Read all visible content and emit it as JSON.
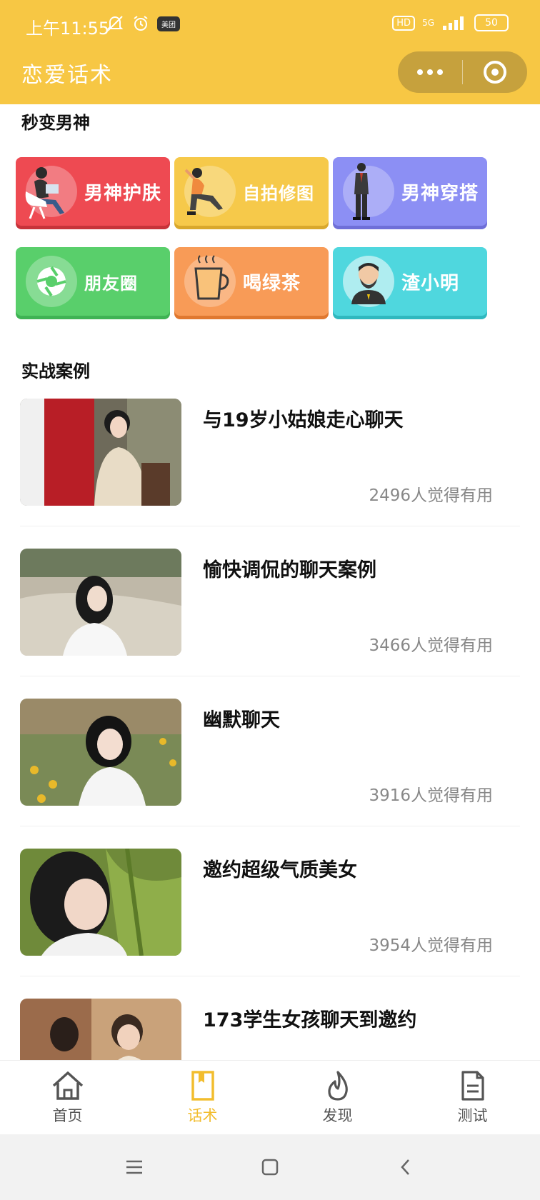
{
  "status": {
    "time": "上午11:55",
    "hd": "HD",
    "network": "5G",
    "battery": "50",
    "app_badge": "美团"
  },
  "header": {
    "title": "恋爱话术",
    "menu_icon": "more-dots-icon",
    "close_icon": "target-icon"
  },
  "section_quick": {
    "title": "秒变男神"
  },
  "tiles": [
    {
      "label": "男神护肤",
      "color": "#ee4a52",
      "icon": "person-laptop-icon"
    },
    {
      "label": "自拍修图",
      "color": "#f6c94a",
      "icon": "kneeling-woman-icon"
    },
    {
      "label": "男神穿搭",
      "color": "#8c8ff4",
      "icon": "man-suit-icon"
    },
    {
      "label": "朋友圈",
      "color": "#59cf6b",
      "icon": "camera-aperture-icon"
    },
    {
      "label": "喝绿茶",
      "color": "#f89b57",
      "icon": "tea-cup-icon"
    },
    {
      "label": "渣小明",
      "color": "#4fd7de",
      "icon": "bearded-man-icon"
    }
  ],
  "section_cases": {
    "title": "实战案例"
  },
  "cases": [
    {
      "title": "与19岁小姑娘走心聊天",
      "count": "2496人觉得有用"
    },
    {
      "title": "愉快调侃的聊天案例",
      "count": "3466人觉得有用"
    },
    {
      "title": "幽默聊天",
      "count": "3916人觉得有用"
    },
    {
      "title": "邀约超级气质美女",
      "count": "3954人觉得有用"
    },
    {
      "title": "173学生女孩聊天到邀约",
      "count": ""
    }
  ],
  "tabbar": {
    "items": [
      {
        "label": "首页",
        "icon": "home-icon"
      },
      {
        "label": "话术",
        "icon": "book-icon",
        "active": true
      },
      {
        "label": "发现",
        "icon": "flame-icon"
      },
      {
        "label": "测试",
        "icon": "document-icon"
      }
    ]
  },
  "colors": {
    "brand": "#f7c744",
    "active_tab": "#f2bd2e"
  }
}
